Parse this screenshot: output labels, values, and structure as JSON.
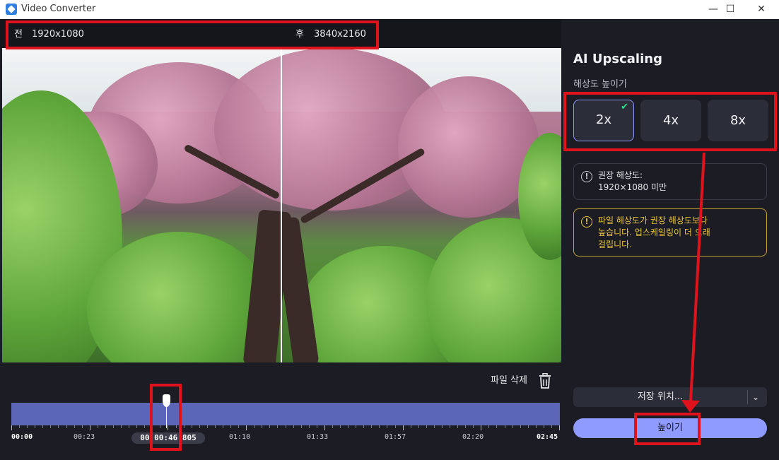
{
  "window": {
    "title": "Video Converter",
    "minimize_icon": "—",
    "maximize_icon": "☐",
    "close_icon": "✕"
  },
  "compare": {
    "before_label": "전",
    "before_resolution": "1920x1080",
    "after_label": "후",
    "after_resolution": "3840x2160"
  },
  "panel": {
    "title": "AI Upscaling",
    "subtitle": "해상도 높이기",
    "scale_options": [
      "2x",
      "4x",
      "8x"
    ],
    "selected_scale": "2x",
    "info_icon": "!",
    "info_line1": "권장 해상도:",
    "info_line2": "1920×1080 미만",
    "warning_icon": "!",
    "warning_line1": "파일 해상도가 권장 해상도보다",
    "warning_line2": "높습니다. 업스케일링이 더 오래",
    "warning_line3": "걸립니다.",
    "save_location_label": "저장 위치...",
    "save_chevron": "⌄",
    "upscale_button": "높이기",
    "info_color": "#c9cad3",
    "warning_color": "#e9c23c",
    "accent_color": "#8f9bff"
  },
  "timeline": {
    "delete_label": "파일 삭제",
    "current_time": "00:00:46.805",
    "playhead_position": 0.283,
    "times": [
      "00:00",
      "00:23",
      "01:10",
      "01:33",
      "01:57",
      "02:20",
      "02:45"
    ]
  }
}
